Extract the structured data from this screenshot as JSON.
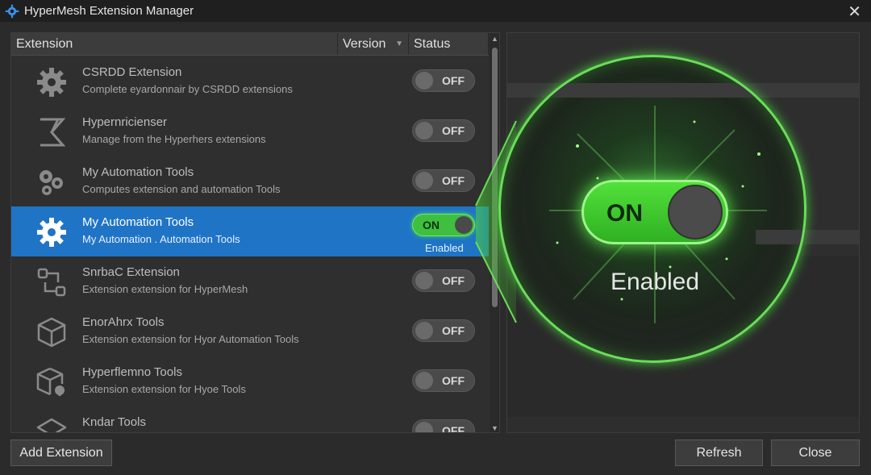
{
  "window": {
    "title": "HyperMesh Extension Manager",
    "close_glyph": "✕"
  },
  "table": {
    "headers": {
      "extension": "Extension",
      "version": "Version",
      "status": "Status"
    },
    "version_sort_glyph": "▼",
    "rows": [
      {
        "name": "CSRDD Extension",
        "desc": "Complete eyardonnair by CSRDD extensions",
        "status": "OFF",
        "icon": "gear-icon"
      },
      {
        "name": "Hypernricienser",
        "desc": "Manage from the Hyperhers extensions",
        "status": "OFF",
        "icon": "sigma-icon"
      },
      {
        "name": "My Automation Tools",
        "desc": "Computes extension and automation Tools",
        "status": "OFF",
        "icon": "gears-icon"
      },
      {
        "name": "My Automation Tools",
        "desc": "My Automation . Automation Tools",
        "status": "ON",
        "enabled_text": "Enabled",
        "icon": "gear-icon",
        "selected": true
      },
      {
        "name": "SnrbaC Extension",
        "desc": "Extension extension for HyperMesh",
        "status": "OFF",
        "icon": "workflow-icon"
      },
      {
        "name": "EnorAhrx Tools",
        "desc": "Extension extension for Hyor Automation Tools",
        "status": "OFF",
        "icon": "cube-icon"
      },
      {
        "name": "Hyperflemno Tools",
        "desc": "Extension extension for Hyoe Tools",
        "status": "OFF",
        "icon": "package-lock-icon"
      },
      {
        "name": "Kndar Tools",
        "desc": "",
        "status": "OFF",
        "icon": "box-icon"
      }
    ]
  },
  "scroll": {
    "up_glyph": "▲",
    "down_glyph": "▼"
  },
  "callout": {
    "toggle_label": "ON",
    "status_text": "Enabled"
  },
  "buttons": {
    "add": "Add Extension",
    "refresh": "Refresh",
    "close": "Close"
  },
  "colors": {
    "accent_green": "#4fd83a",
    "selection_blue": "#1f74c6",
    "background": "#2b2b2b"
  }
}
